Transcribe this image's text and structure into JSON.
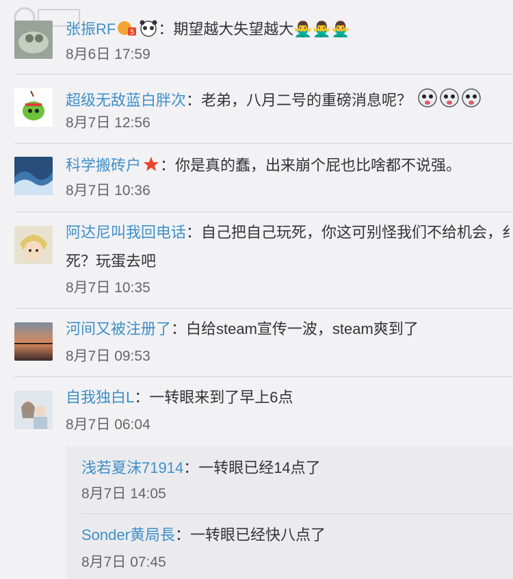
{
  "comments": [
    {
      "user": "张振RF",
      "text": "：期望越大失望越大🙅‍♂️🙅‍♂️🙅‍♂️",
      "time": "8月6日 17:59"
    },
    {
      "user": "超级无敌蓝白胖次",
      "text": "：老弟，八月二号的重磅消息呢？",
      "time": "8月7日 12:56"
    },
    {
      "user": "科学搬砖户",
      "text": "：你是真的蠢，出来崩个屁也比啥都不说强。",
      "time": "8月7日 10:36"
    },
    {
      "user": "阿达尼叫我回电话",
      "text": "：自己把自己玩死，你这可别怪我们不给机会，纟",
      "text2": "死？玩蛋去吧",
      "time": "8月7日 10:35"
    },
    {
      "user": "河间又被注册了",
      "text": "：白给steam宣传一波，steam爽到了",
      "time": "8月7日 09:53"
    },
    {
      "user": "自我独白L",
      "text": "：一转眼来到了早上6点",
      "time": "8月7日 06:04"
    }
  ],
  "replies": [
    {
      "user": "浅若夏沫71914",
      "text": "：一转眼已经14点了",
      "time": "8月7日 14:05"
    },
    {
      "user": "Sonder黄局長",
      "text": "：一转眼已经快八点了",
      "time": "8月7日 07:45"
    }
  ],
  "colors": {
    "name": "#3f8fc8",
    "text": "#333333",
    "time": "#666666",
    "background": "#f2f2f5"
  }
}
